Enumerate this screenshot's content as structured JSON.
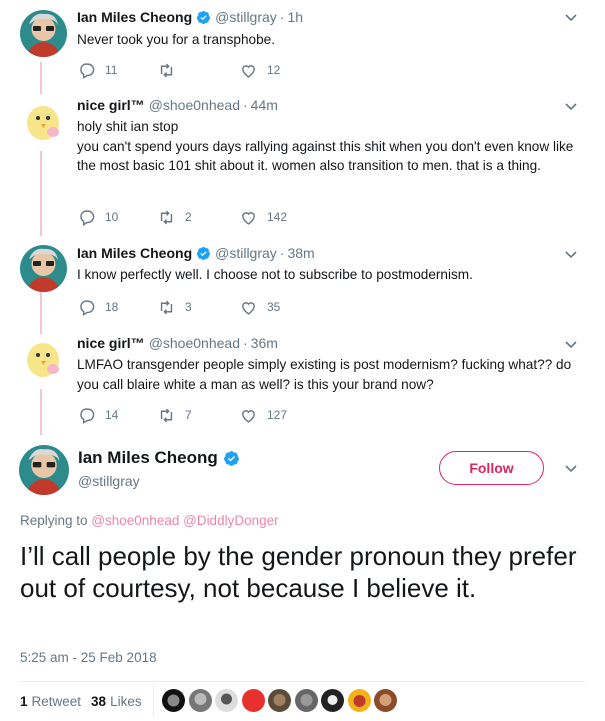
{
  "tweets": [
    {
      "name": "Ian Miles Cheong",
      "handle": "@stillgray",
      "time": "1h",
      "verified": true,
      "text": "Never took you for a transphobe.",
      "replies": "11",
      "retweets": "",
      "likes": "12"
    },
    {
      "name": "nice girl™",
      "handle": "@shoe0nhead",
      "time": "44m",
      "verified": false,
      "text": "holy shit ian stop\nyou can't spend yours days rallying against this shit when you don't even know like the most basic 101 shit about it. women also transition to men. that is a thing.",
      "replies": "10",
      "retweets": "2",
      "likes": "142"
    },
    {
      "name": "Ian Miles Cheong",
      "handle": "@stillgray",
      "time": "38m",
      "verified": true,
      "text": "I know perfectly well. I choose not to subscribe to postmodernism.",
      "replies": "18",
      "retweets": "3",
      "likes": "35"
    },
    {
      "name": "nice girl™",
      "handle": "@shoe0nhead",
      "time": "36m",
      "verified": false,
      "text": "LMFAO transgender people simply existing is post modernism? fucking what?? do you call blaire white a man as well? is this your brand now?",
      "replies": "14",
      "retweets": "7",
      "likes": "127"
    }
  ],
  "main": {
    "name": "Ian Miles Cheong",
    "handle": "@stillgray",
    "follow_label": "Follow",
    "replying_prefix": "Replying to",
    "replying_to_1": "@shoe0nhead",
    "replying_to_2": "@DiddlyDonger",
    "text": "I’ll call people by the gender pronoun they prefer out of courtesy, not because I believe it.",
    "timestamp": "5:25 am - 25 Feb 2018",
    "retweet_count": "1",
    "retweet_label": "Retweet",
    "like_count": "38",
    "like_label": "Likes"
  },
  "colors": {
    "accent": "#e0245e",
    "verified": "#1da1f2",
    "muted": "#657786",
    "thread_line": "#f5c5d7"
  },
  "icons": [
    "reply-icon",
    "retweet-icon",
    "like-icon",
    "verified-icon",
    "chevron-down-icon"
  ]
}
